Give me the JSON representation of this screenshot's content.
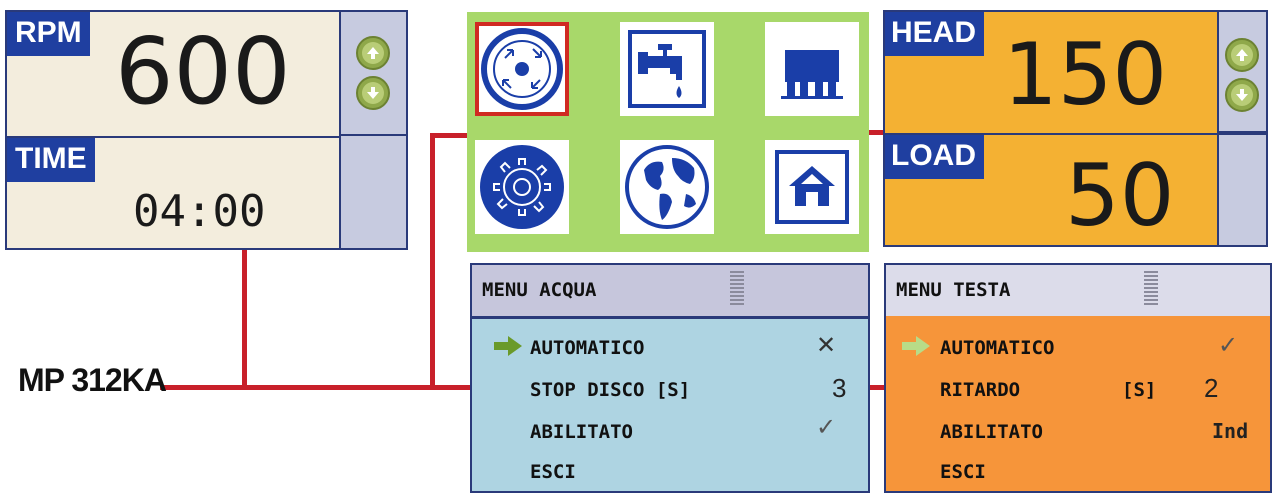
{
  "model_label": "MP 312KA",
  "screen_rpm": {
    "rpm_label": "RPM",
    "rpm_value": "600",
    "time_label": "TIME",
    "time_value": "04:00"
  },
  "screen_icons": {
    "icons": [
      "rotation-icon",
      "water-tap-icon",
      "machine-head-icon",
      "gear-icon",
      "globe-icon",
      "home-icon"
    ],
    "selected": "rotation-icon"
  },
  "screen_head": {
    "head_label": "HEAD",
    "head_value": "150",
    "load_label": "LOAD",
    "load_value": "50"
  },
  "menu_acqua": {
    "title": "MENU ACQUA",
    "rows": [
      {
        "label": "AUTOMATICO",
        "value": "✕"
      },
      {
        "label": "STOP DISCO [S]",
        "value": "3"
      },
      {
        "label": "ABILITATO",
        "value": "✓"
      },
      {
        "label": "ESCI",
        "value": ""
      }
    ]
  },
  "menu_testa": {
    "title": "MENU TESTA",
    "rows": [
      {
        "label": "AUTOMATICO",
        "value": "✓"
      },
      {
        "label": "RITARDO",
        "unit": "[S]",
        "value": "2"
      },
      {
        "label": "ABILITATO",
        "value": "Ind"
      },
      {
        "label": "ESCI",
        "value": ""
      }
    ]
  },
  "colors": {
    "connector": "#c8202a",
    "screen_border": "#2a3a7a",
    "tag_blue": "#1f3fa0",
    "icon_blue": "#1a3ea8",
    "orange": "#f4b133",
    "menu_blue": "#aed4e2",
    "menu_orange": "#f6953a",
    "green_bg": "#a8d86a"
  }
}
